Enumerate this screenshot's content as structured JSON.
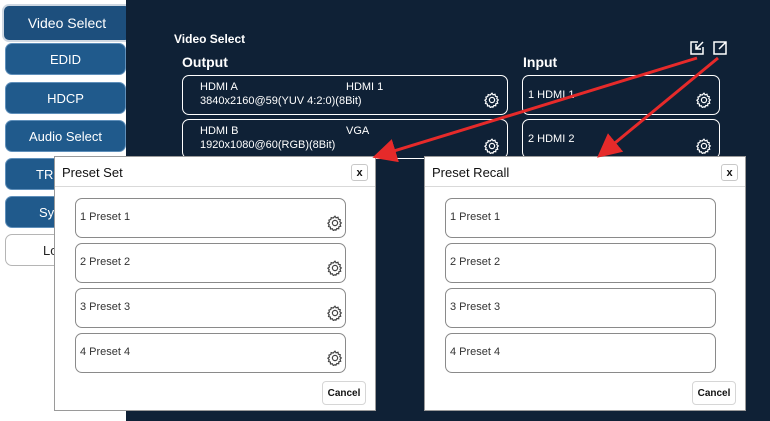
{
  "sidebar": {
    "items": [
      {
        "label": "Video Select",
        "state": "active"
      },
      {
        "label": "EDID",
        "state": "normal"
      },
      {
        "label": "HDCP",
        "state": "normal"
      },
      {
        "label": "Audio Select",
        "state": "normal"
      },
      {
        "label": "TR",
        "state": "normal"
      },
      {
        "label": "Sy",
        "state": "normal"
      },
      {
        "label": "Lo",
        "state": "white"
      }
    ]
  },
  "main": {
    "section_title": "Video Select",
    "output_header": "Output",
    "input_header": "Input",
    "outputs": [
      {
        "name": "HDMI A",
        "source": "HDMI 1",
        "resolution": "3840x2160@59(YUV 4:2:0)(8Bit)"
      },
      {
        "name": "HDMI B",
        "source": "VGA",
        "resolution": "1920x1080@60(RGB)(8Bit)"
      }
    ],
    "inputs": [
      {
        "label": "1  HDMI 1"
      },
      {
        "label": "2  HDMI 2"
      }
    ],
    "icons": {
      "save": "preset-save-icon",
      "recall": "preset-recall-icon",
      "settings": "gear-icon"
    }
  },
  "preset_set": {
    "title": "Preset Set",
    "close": "x",
    "items": [
      "1  Preset 1",
      "2  Preset 2",
      "3  Preset 3",
      "4  Preset 4"
    ],
    "cancel": "Cancel"
  },
  "preset_recall": {
    "title": "Preset Recall",
    "close": "x",
    "items": [
      "1  Preset 1",
      "2  Preset 2",
      "3  Preset 3",
      "4  Preset 4"
    ],
    "cancel": "Cancel"
  },
  "colors": {
    "panel": "#0f2136",
    "sidebar_button": "#205a8c",
    "arrow": "#e62a2a"
  }
}
